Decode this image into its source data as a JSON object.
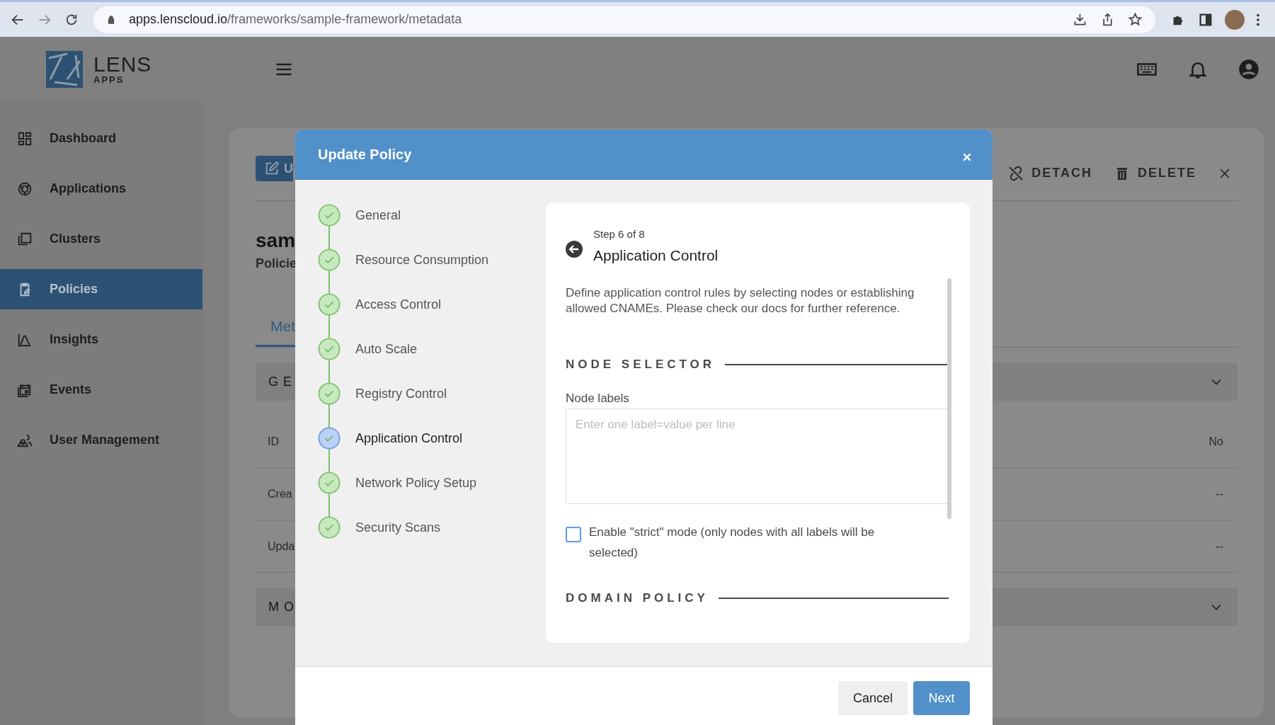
{
  "browser": {
    "url_host": "apps.lenscloud.io",
    "url_path": "/frameworks/sample-framework/metadata"
  },
  "app": {
    "logo_name": "LENS",
    "logo_sub": "APPS"
  },
  "sidebar": {
    "items": [
      {
        "label": "Dashboard",
        "selected": false
      },
      {
        "label": "Applications",
        "selected": false
      },
      {
        "label": "Clusters",
        "selected": false
      },
      {
        "label": "Policies",
        "selected": true
      },
      {
        "label": "Insights",
        "selected": false
      },
      {
        "label": "Events",
        "selected": false
      },
      {
        "label": "User Management",
        "selected": false
      }
    ]
  },
  "page": {
    "update_button": "U",
    "actions": [
      "DETACH",
      "DELETE"
    ],
    "title": "sam",
    "subtitle": "Policie",
    "tabs": [
      {
        "label": "Met",
        "selected": true
      }
    ],
    "sections": [
      {
        "title": "GE",
        "rows": [
          {
            "label": "ID",
            "value": "No"
          },
          {
            "label": "Crea",
            "value": "--"
          },
          {
            "label": "Upda",
            "value": "--"
          }
        ]
      },
      {
        "title": "MO"
      }
    ]
  },
  "dialog": {
    "title": "Update Policy",
    "steps": [
      {
        "label": "General",
        "done": true,
        "selected": false
      },
      {
        "label": "Resource Consumption",
        "done": true,
        "selected": false
      },
      {
        "label": "Access Control",
        "done": true,
        "selected": false
      },
      {
        "label": "Auto Scale",
        "done": true,
        "selected": false
      },
      {
        "label": "Registry Control",
        "done": true,
        "selected": false
      },
      {
        "label": "Application Control",
        "done": true,
        "selected": true
      },
      {
        "label": "Network Policy Setup",
        "done": true,
        "selected": false
      },
      {
        "label": "Security Scans",
        "done": true,
        "selected": false
      }
    ],
    "step_counter": "Step 6 of 8",
    "heading": "Application Control",
    "description": "Define application control rules by selecting nodes or establishing allowed CNAMEs. Please check our docs for further reference.",
    "node_selector": {
      "heading": "NODE SELECTOR",
      "field_label": "Node labels",
      "placeholder": "Enter one label=value per line",
      "strict": {
        "label": "Enable \"strict\" mode (only nodes with all labels will be selected)",
        "checked": false
      }
    },
    "domain_policy": {
      "heading": "DOMAIN POLICY"
    },
    "buttons": [
      {
        "label": "Cancel",
        "kind": "secondary"
      },
      {
        "label": "Next",
        "kind": "primary"
      }
    ]
  }
}
